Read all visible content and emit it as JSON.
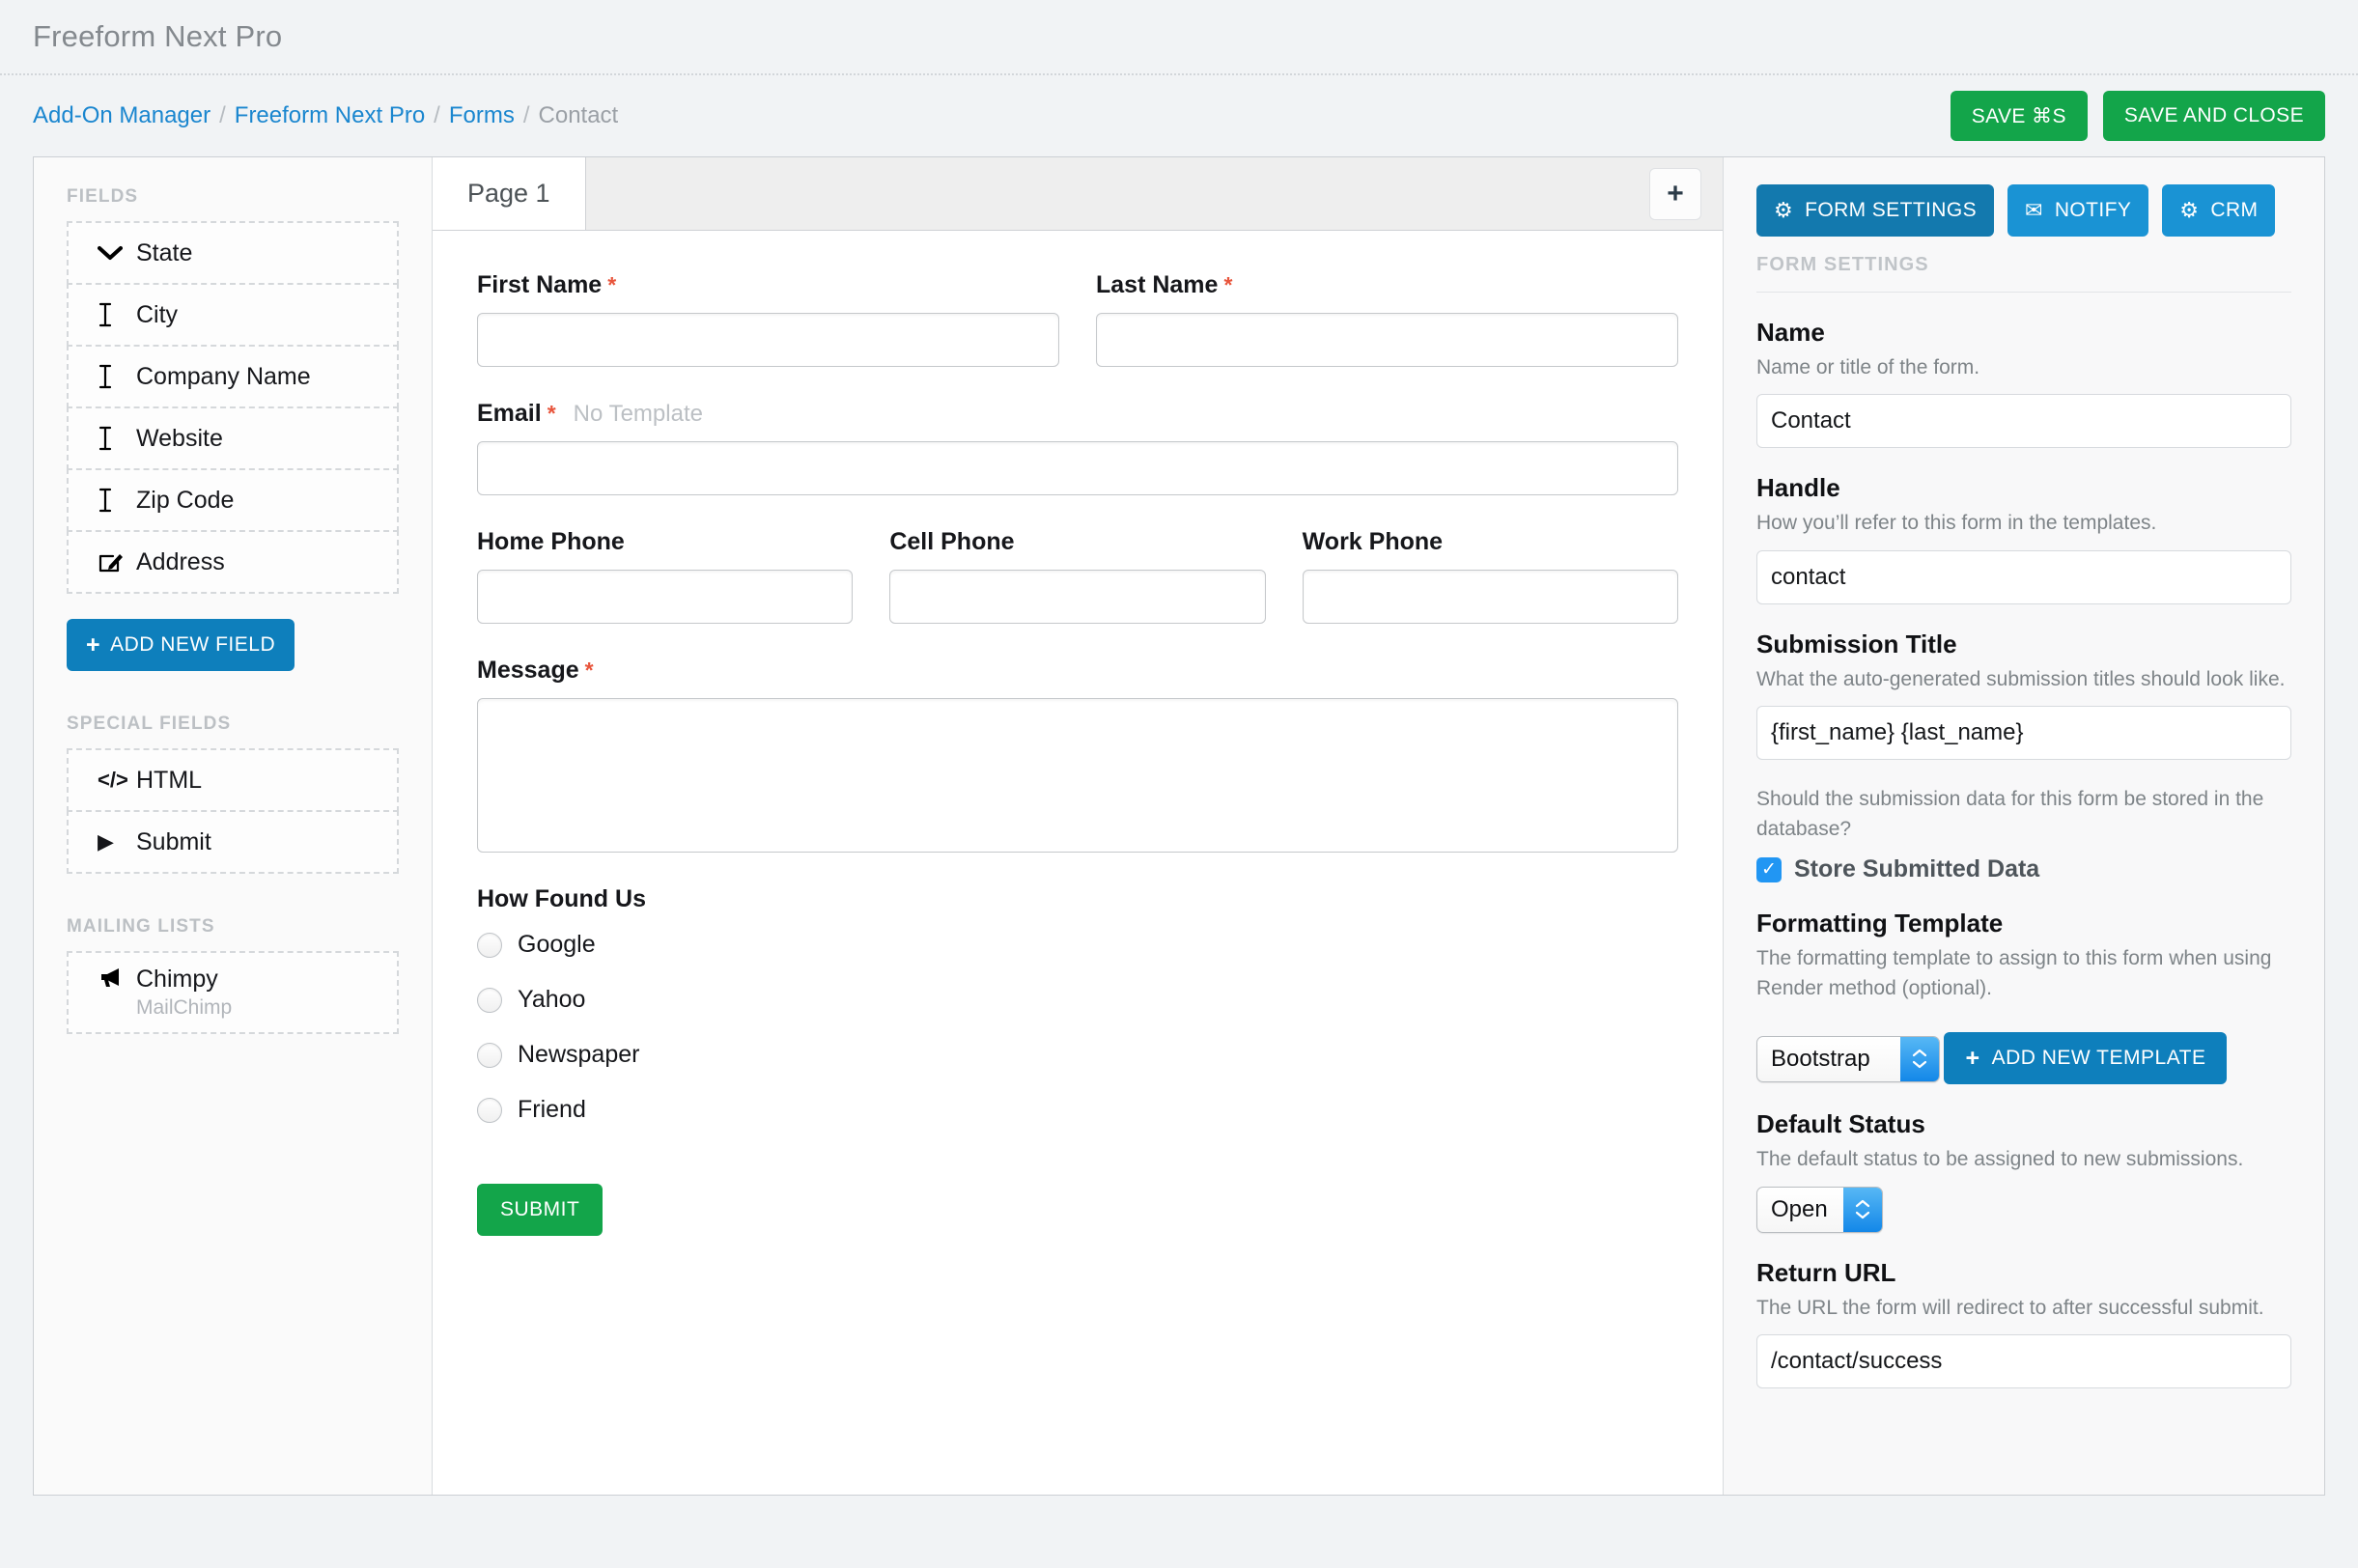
{
  "app": {
    "title": "Freeform Next Pro"
  },
  "breadcrumb": {
    "items": [
      {
        "label": "Add-On Manager",
        "current": false
      },
      {
        "label": "Freeform Next Pro",
        "current": false
      },
      {
        "label": "Forms",
        "current": false
      },
      {
        "label": "Contact",
        "current": true
      }
    ],
    "separator": "/"
  },
  "header_actions": {
    "save_label": "SAVE ⌘S",
    "save_close_label": "SAVE AND CLOSE"
  },
  "sidebar": {
    "fields_heading": "FIELDS",
    "fields": [
      {
        "label": "State",
        "icon": "chevron-down-icon",
        "glyph": "⌄"
      },
      {
        "label": "City",
        "icon": "text-cursor-icon",
        "glyph": "I"
      },
      {
        "label": "Company Name",
        "icon": "text-cursor-icon",
        "glyph": "I"
      },
      {
        "label": "Website",
        "icon": "text-cursor-icon",
        "glyph": "I"
      },
      {
        "label": "Zip Code",
        "icon": "text-cursor-icon",
        "glyph": "I"
      },
      {
        "label": "Address",
        "icon": "pencil-square-icon",
        "glyph": "✎"
      }
    ],
    "add_field_label": "ADD NEW FIELD",
    "special_heading": "SPECIAL FIELDS",
    "special_fields": [
      {
        "label": "HTML",
        "icon": "code-icon",
        "glyph": "</>"
      },
      {
        "label": "Submit",
        "icon": "play-triangle-icon",
        "glyph": "▶"
      }
    ],
    "mailing_heading": "MAILING LISTS",
    "mailing_lists": [
      {
        "label": "Chimpy",
        "sub": "MailChimp",
        "icon": "megaphone-icon",
        "glyph": "📢"
      }
    ]
  },
  "canvas": {
    "tabs": [
      {
        "label": "Page 1",
        "active": true
      }
    ],
    "add_page_label": "+",
    "fields": {
      "first_name": {
        "label": "First Name",
        "required": "*",
        "value": ""
      },
      "last_name": {
        "label": "Last Name",
        "required": "*",
        "value": ""
      },
      "email": {
        "label": "Email",
        "required": "*",
        "note": "No Template",
        "value": ""
      },
      "home_phone": {
        "label": "Home Phone",
        "value": ""
      },
      "cell_phone": {
        "label": "Cell Phone",
        "value": ""
      },
      "work_phone": {
        "label": "Work Phone",
        "value": ""
      },
      "message": {
        "label": "Message",
        "required": "*",
        "value": ""
      },
      "how_found_us": {
        "label": "How Found Us",
        "options": [
          {
            "label": "Google",
            "checked": false
          },
          {
            "label": "Yahoo",
            "checked": false
          },
          {
            "label": "Newspaper",
            "checked": false
          },
          {
            "label": "Friend",
            "checked": false
          }
        ]
      }
    },
    "submit_label": "SUBMIT"
  },
  "settings": {
    "segments": [
      {
        "label": "FORM SETTINGS",
        "icon": "gear-icon",
        "glyph": "⚙",
        "active": true
      },
      {
        "label": "NOTIFY",
        "icon": "envelope-icon",
        "glyph": "✉",
        "active": false
      },
      {
        "label": "CRM",
        "icon": "gear-icon",
        "glyph": "⚙",
        "active": false
      }
    ],
    "panel_title": "FORM SETTINGS",
    "name": {
      "heading": "Name",
      "description": "Name or title of the form.",
      "value": "Contact"
    },
    "handle": {
      "heading": "Handle",
      "description": "How you’ll refer to this form in the templates.",
      "value": "contact"
    },
    "submission_title": {
      "heading": "Submission Title",
      "description": "What the auto-generated submission titles should look like.",
      "value": "{first_name} {last_name}"
    },
    "store_data": {
      "description": "Should the submission data for this form be stored in the database?",
      "label": "Store Submitted Data",
      "checked": true,
      "check_glyph": "✓"
    },
    "formatting_template": {
      "heading": "Formatting Template",
      "description": "The formatting template to assign to this form when using Render method (optional).",
      "value": "Bootstrap",
      "add_label": "ADD NEW TEMPLATE"
    },
    "default_status": {
      "heading": "Default Status",
      "description": "The default status to be assigned to new submissions.",
      "value": "Open"
    },
    "return_url": {
      "heading": "Return URL",
      "description": "The URL the form will redirect to after successful submit.",
      "value": "/contact/success"
    }
  },
  "colors": {
    "green": "#13a54a",
    "blue": "#0e7fbc",
    "link": "#1a86cf",
    "required": "#e8553c",
    "checkbox": "#2196f3"
  }
}
